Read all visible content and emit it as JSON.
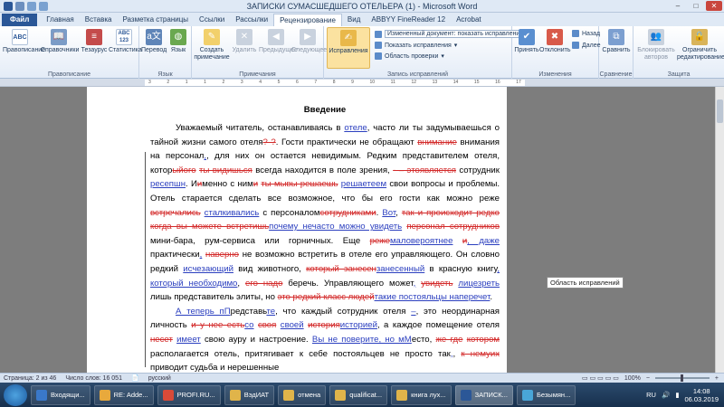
{
  "window": {
    "title": "ЗАПИСКИ СУМАСШЕДШЕГО ОТЕЛЬЕРА (1) - Microsoft Word",
    "min": "–",
    "max": "□",
    "close": "✕"
  },
  "tabs": [
    "Файл",
    "Главная",
    "Вставка",
    "Разметка страницы",
    "Ссылки",
    "Рассылки",
    "Рецензирование",
    "Вид",
    "ABBYY FineReader 12",
    "Acrobat"
  ],
  "ribbon": {
    "proofing": {
      "label": "Правописание",
      "spelling": "Правописание",
      "refs": "Справочники",
      "thesaurus": "Тезаурус",
      "stats": "Статистика"
    },
    "language": {
      "label": "Язык",
      "translate": "Перевод",
      "lang": "Язык"
    },
    "comments": {
      "label": "Примечания",
      "create": "Создать примечание",
      "delete": "Удалить",
      "prev": "Предыдущее",
      "next": "Следующее"
    },
    "tracking": {
      "label": "Запись исправлений",
      "track": "Исправления",
      "display": "Измененный документ: показать исправления",
      "show_markup": "Показать исправления",
      "pane": "Область проверки"
    },
    "changes": {
      "label": "Изменения",
      "accept": "Принять",
      "reject": "Отклонить",
      "prev": "Назад",
      "next": "Далее"
    },
    "compare": {
      "label": "Сравнение",
      "compare": "Сравнить"
    },
    "protect": {
      "label": "Защита",
      "block": "Блокировать авторов",
      "restrict": "Ограничить редактирование"
    }
  },
  "ruler_marks": [
    "3",
    "2",
    "1",
    "1",
    "2",
    "3",
    "4",
    "5",
    "6",
    "7",
    "8",
    "9",
    "10",
    "11",
    "12",
    "13",
    "14",
    "15",
    "16",
    "17"
  ],
  "doc": {
    "heading": "Введение"
  },
  "tooltip": "Область исправлений",
  "status": {
    "page": "Страница: 2 из 46",
    "words": "Число слов: 16 051",
    "lang": "русский",
    "zoom": "100%"
  },
  "taskbar": [
    {
      "label": "Входящи...",
      "color": "#3a78c9"
    },
    {
      "label": "RE: Adde...",
      "color": "#e8a93c"
    },
    {
      "label": "PROFI.RU...",
      "color": "#d94a38"
    },
    {
      "label": "ВэдИАТ",
      "color": "#e0b44a"
    },
    {
      "label": "отмена",
      "color": "#e0b44a"
    },
    {
      "label": "qualificat...",
      "color": "#e0b44a"
    },
    {
      "label": "книга лух...",
      "color": "#e0b44a"
    },
    {
      "label": "ЗАПИСК...",
      "color": "#2b5797"
    },
    {
      "label": "Безымян...",
      "color": "#49a6d8"
    }
  ],
  "tray": {
    "lang": "RU",
    "time": "14:08",
    "date": "06.03.2019"
  }
}
